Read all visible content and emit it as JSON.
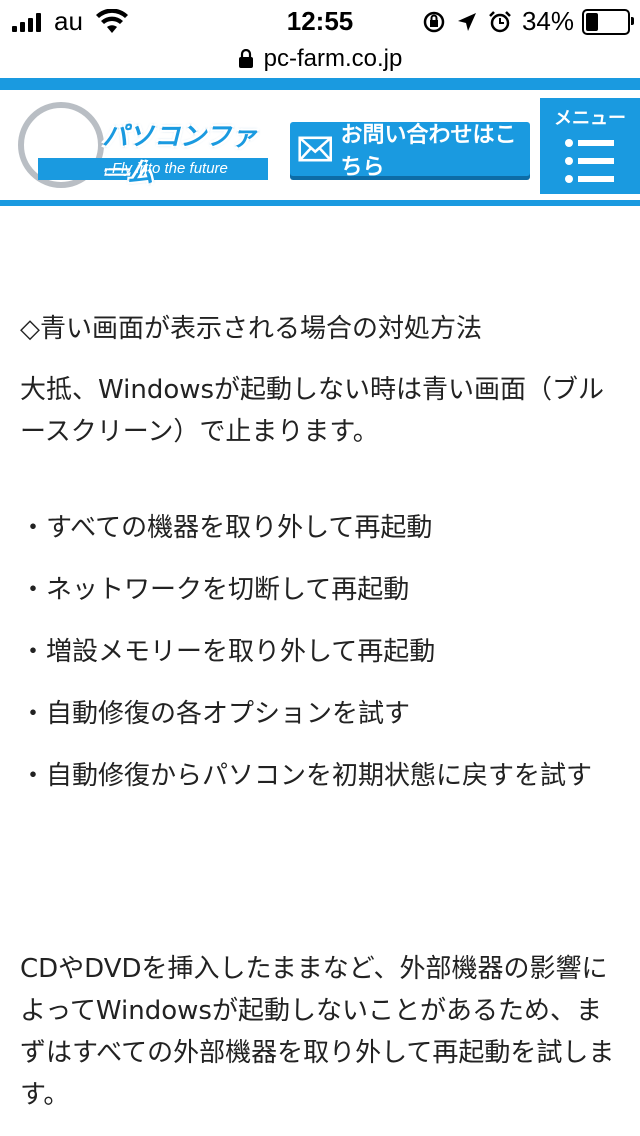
{
  "status_bar": {
    "carrier": "au",
    "time": "12:55",
    "battery": "34%",
    "battery_level": 0.34
  },
  "browser": {
    "url": "pc-farm.co.jp"
  },
  "site_header": {
    "logo_title": "パソコンファーム",
    "logo_tagline": "Fly into the future",
    "contact_button": "お問い合わせはこちら",
    "menu_label": "メニュー",
    "accent_color": "#1a9ae0"
  },
  "article": {
    "heading": "◇青い画面が表示される場合の対処方法",
    "intro": "大抵、Windowsが起動しない時は青い画面（ブルースクリーン）で止まります。",
    "list_items": [
      "・すべての機器を取り外して再起動",
      "・ネットワークを切断して再起動",
      "・増設メモリーを取り外して再起動",
      "・自動修復の各オプションを試す",
      "・自動修復からパソコンを初期状態に戻すを試す"
    ],
    "outro": "CDやDVDを挿入したままなど、外部機器の影響によってWindowsが起動しないことがあるため、まずはすべての外部機器を取り外して再起動を試します。"
  }
}
